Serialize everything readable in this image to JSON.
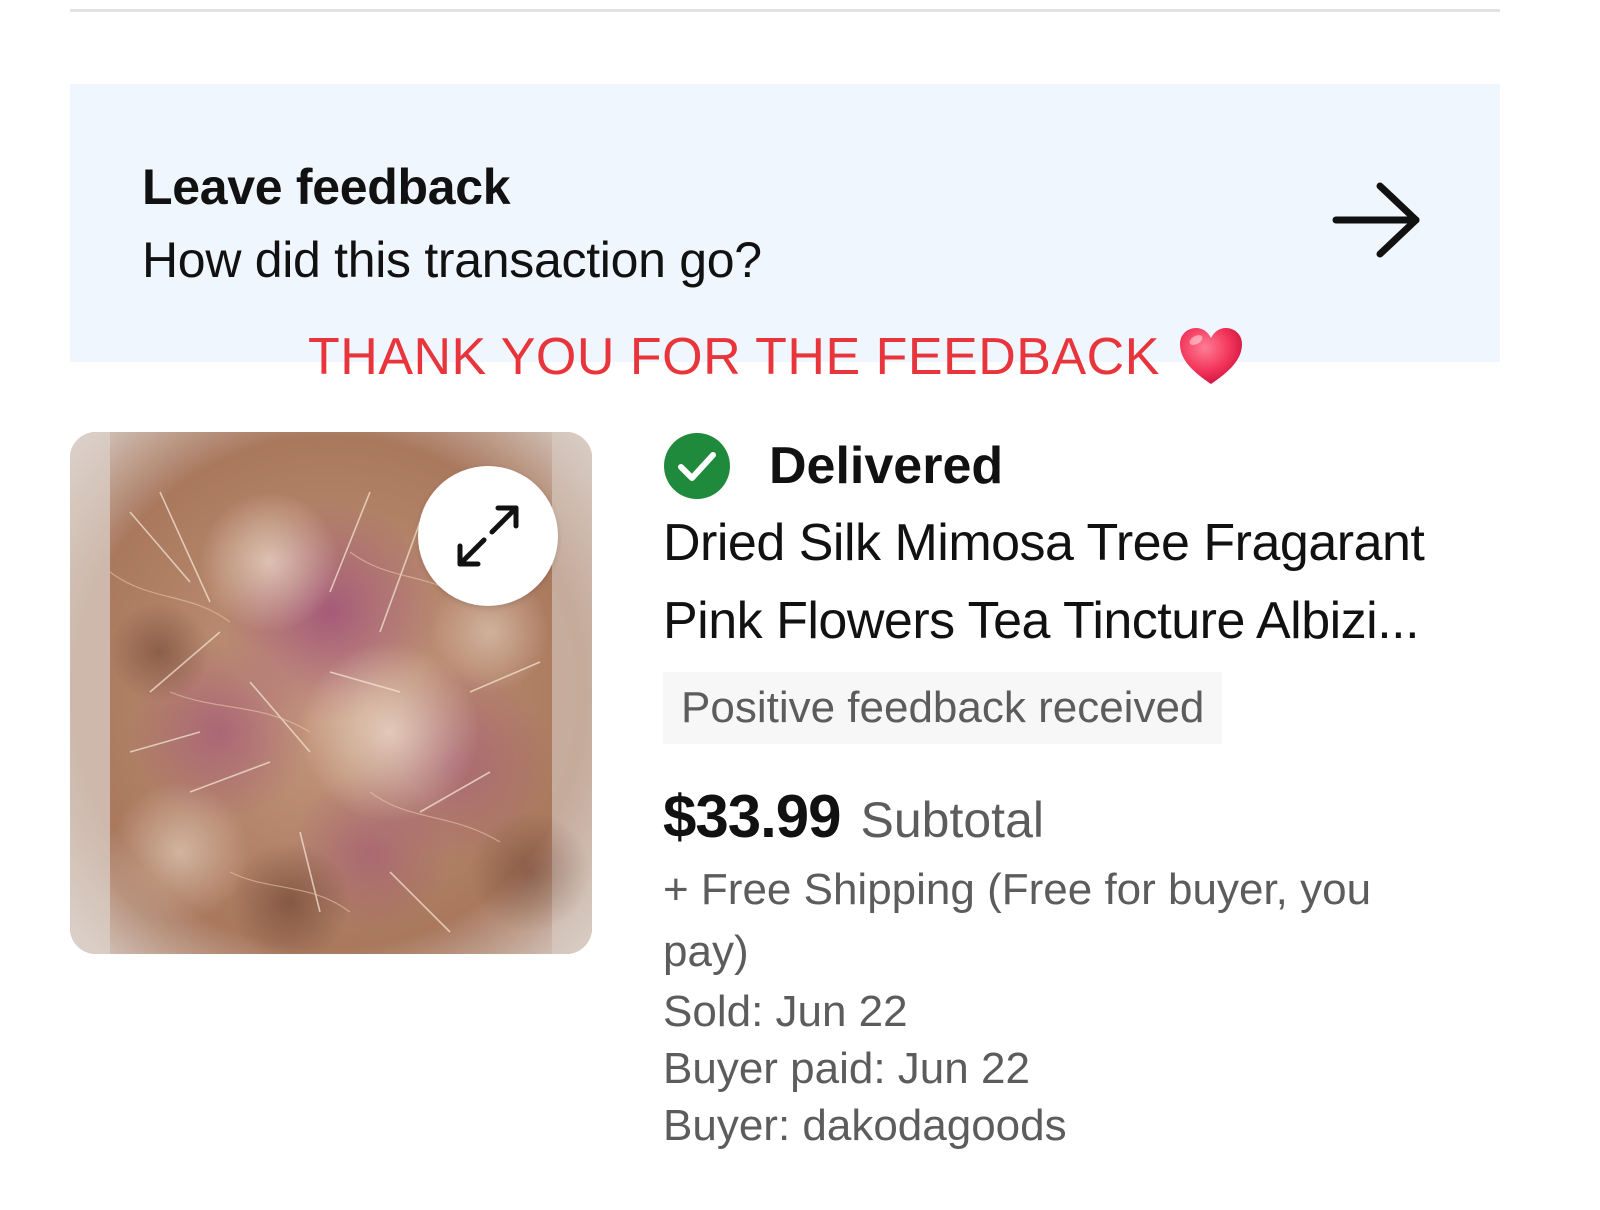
{
  "feedback_banner": {
    "title": "Leave feedback",
    "subtitle": "How did this transaction go?",
    "arrow_icon": "arrow-right-icon"
  },
  "overlay": {
    "text": "THANK YOU FOR THE FEEDBACK",
    "icon": "heart-icon",
    "color": "#e8353b"
  },
  "order": {
    "status": "Delivered",
    "status_icon": "check-circle-icon",
    "status_color": "#1f8a3c",
    "title_line1": "Dried Silk Mimosa Tree Fragarant",
    "title_line2": "Pink Flowers Tea Tincture Albizi...",
    "feedback_chip": "Positive feedback received",
    "price": "$33.99",
    "price_label": "Subtotal",
    "shipping": "+ Free Shipping (Free for buyer, you pay)",
    "sold": "Sold: Jun 22",
    "buyer_paid": "Buyer paid: Jun 22",
    "buyer": "Buyer: dakodagoods"
  },
  "image": {
    "expand_icon": "expand-icon"
  },
  "colors": {
    "banner_bg": "#f0f6fd",
    "text_primary": "#111111",
    "text_secondary": "#5c5c5c",
    "chip_bg": "#f7f7f7"
  }
}
